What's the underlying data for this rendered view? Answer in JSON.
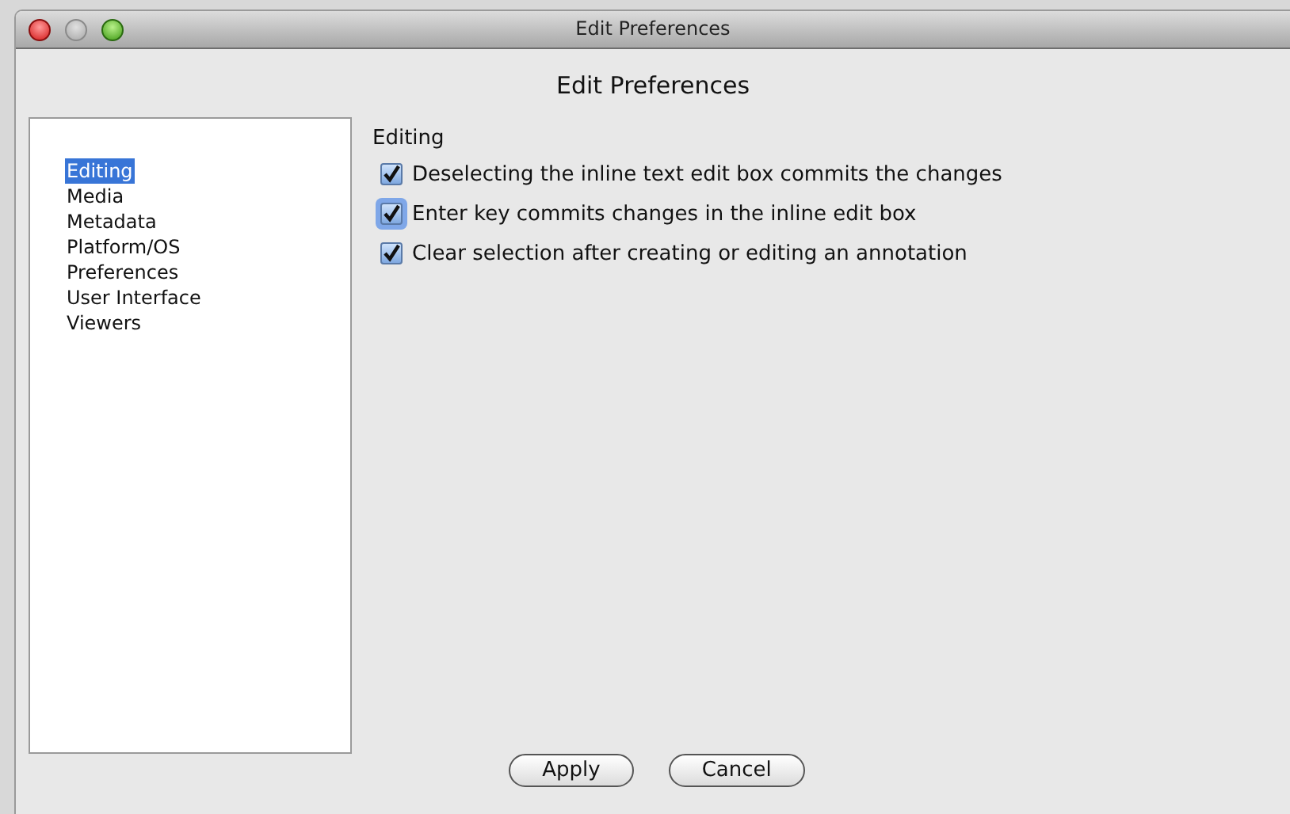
{
  "window": {
    "title": "Edit Preferences"
  },
  "heading": "Edit Preferences",
  "sidebar": {
    "items": [
      {
        "label": "Editing",
        "selected": true
      },
      {
        "label": "Media",
        "selected": false
      },
      {
        "label": "Metadata",
        "selected": false
      },
      {
        "label": "Platform/OS",
        "selected": false
      },
      {
        "label": "Preferences",
        "selected": false
      },
      {
        "label": "User Interface",
        "selected": false
      },
      {
        "label": "Viewers",
        "selected": false
      }
    ]
  },
  "section": {
    "title": "Editing",
    "options": [
      {
        "label": "Deselecting the inline text edit box commits the changes",
        "checked": true,
        "focused": false
      },
      {
        "label": "Enter key commits changes in the inline edit box",
        "checked": true,
        "focused": true
      },
      {
        "label": "Clear selection after creating or editing an annotation",
        "checked": true,
        "focused": false
      }
    ]
  },
  "buttons": [
    "Apply",
    "Cancel"
  ]
}
